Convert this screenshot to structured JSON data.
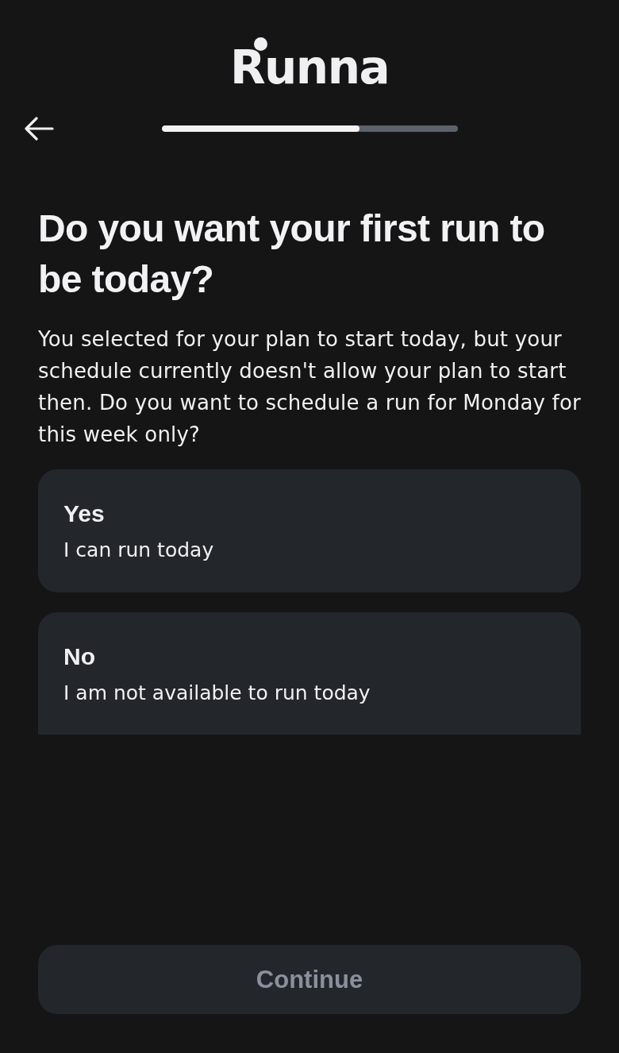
{
  "header": {
    "logo": "Runna",
    "progress": {
      "level": 0.67
    }
  },
  "question": {
    "title": "Do you want your first run to be today?",
    "description": "You selected for your plan to start today, but your schedule currently doesn't allow your plan to start then. Do you want to schedule a run for Monday for this week only?"
  },
  "options": [
    {
      "title": "Yes",
      "subtitle": "I can run today",
      "selected": false
    },
    {
      "title": "No",
      "subtitle": "I am not available to run today",
      "selected": false
    }
  ],
  "continue_button": {
    "label": "Continue",
    "disabled": true
  }
}
